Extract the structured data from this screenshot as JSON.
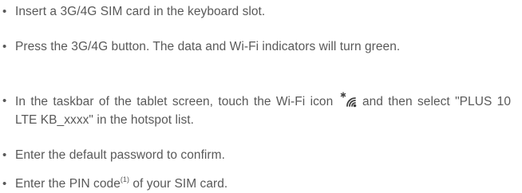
{
  "instructions": {
    "bullet_symbol": "•",
    "items": [
      {
        "text": "Insert a 3G/4G SIM card in the keyboard slot."
      },
      {
        "text": "Press the 3G/4G button. The data and Wi-Fi indicators will turn green."
      },
      {
        "text_before_icon": "In the taskbar of the tablet screen, touch the Wi-Fi icon",
        "icon": "wifi-icon",
        "text_after_icon": "and then select \"PLUS 10 LTE KB_xxxx\" in the hotspot list."
      },
      {
        "text": "Enter the default password to confirm."
      },
      {
        "text_before_note": "Enter the PIN code",
        "footnote_ref": "(1)",
        "text_after_note": " of your SIM card."
      }
    ]
  }
}
